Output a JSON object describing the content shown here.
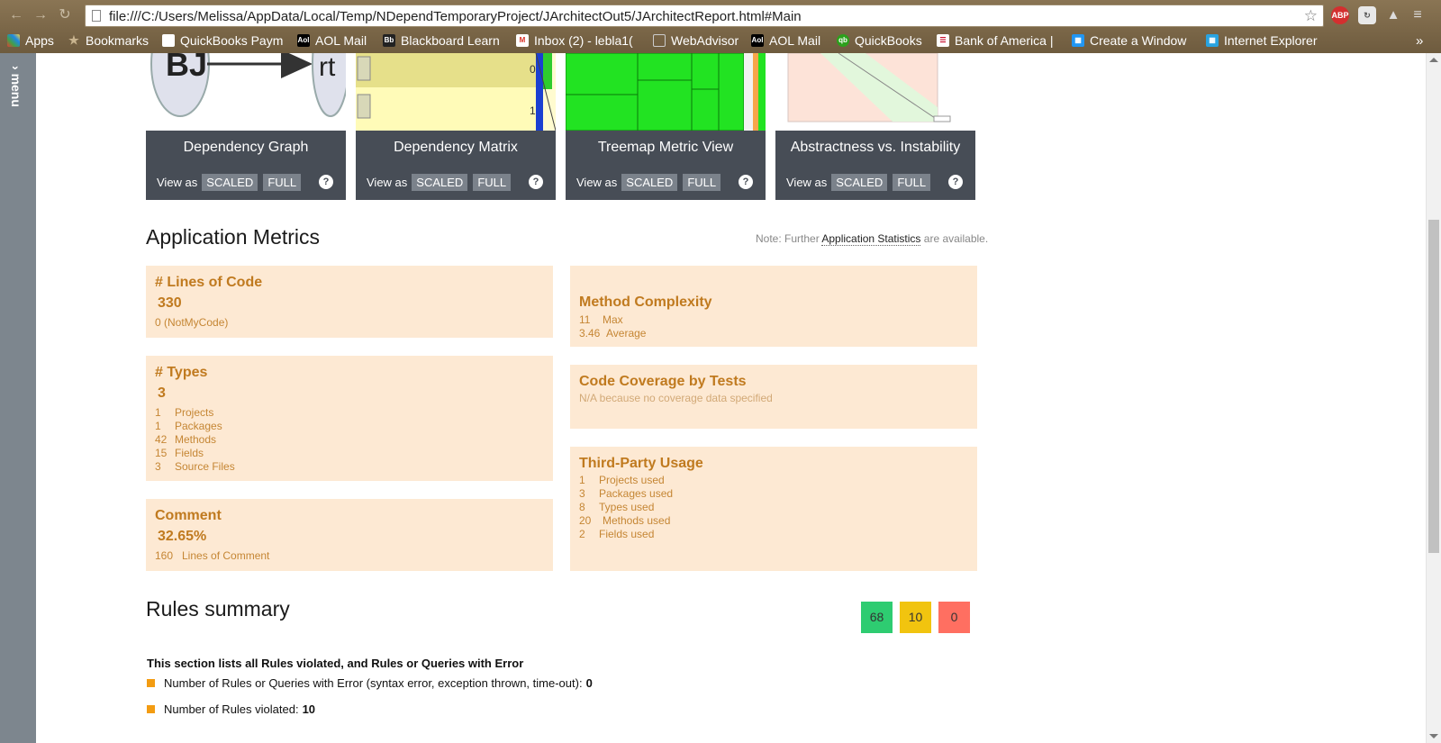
{
  "browser": {
    "url": "file:///C:/Users/Melissa/AppData/Local/Temp/NDependTemporaryProject/JArchitectOut5/JArchitectReport.html#Main",
    "extensions": [
      "ABP"
    ],
    "bookmarks": [
      {
        "label": "Apps"
      },
      {
        "label": "Bookmarks"
      },
      {
        "label": "QuickBooks Paym"
      },
      {
        "label": "AOL Mail"
      },
      {
        "label": "Blackboard Learn"
      },
      {
        "label": "Inbox (2) - lebla1("
      },
      {
        "label": "WebAdvisor"
      },
      {
        "label": "AOL Mail"
      },
      {
        "label": "QuickBooks"
      },
      {
        "label": "Bank of America |"
      },
      {
        "label": "Create a Window"
      },
      {
        "label": "Internet Explorer"
      }
    ]
  },
  "side_menu": {
    "label": "menu"
  },
  "cards": [
    {
      "title": "Dependency Graph",
      "view_as": "View as",
      "scaled": "SCALED",
      "full": "FULL",
      "help": "?",
      "thumb_text_a": "BJ",
      "thumb_text_b": "rt"
    },
    {
      "title": "Dependency Matrix",
      "view_as": "View as",
      "scaled": "SCALED",
      "full": "FULL",
      "help": "?"
    },
    {
      "title": "Treemap Metric View",
      "view_as": "View as",
      "scaled": "SCALED",
      "full": "FULL",
      "help": "?"
    },
    {
      "title": "Abstractness vs. Instability",
      "view_as": "View as",
      "scaled": "SCALED",
      "full": "FULL",
      "help": "?"
    }
  ],
  "app_metrics": {
    "title": "Application Metrics",
    "note_prefix": "Note: Further",
    "note_link": "Application Statistics",
    "note_suffix": "are available.",
    "loc": {
      "title": "# Lines of Code",
      "value": "330",
      "sub": "0 (NotMyCode)"
    },
    "types": {
      "title": "# Types",
      "value": "3",
      "rows": [
        {
          "n": "1",
          "label": "Projects"
        },
        {
          "n": "1",
          "label": "Packages"
        },
        {
          "n": "42",
          "label": "Methods"
        },
        {
          "n": "15",
          "label": "Fields"
        },
        {
          "n": "3",
          "label": "Source Files"
        }
      ]
    },
    "comment": {
      "title": "Comment",
      "value": "32.65%",
      "row": {
        "n": "160",
        "label": "Lines of Comment"
      }
    },
    "complexity": {
      "title": "Method Complexity",
      "rows": [
        {
          "n": "11",
          "label": "Max"
        },
        {
          "n": "3.46",
          "label": "Average"
        }
      ]
    },
    "coverage": {
      "title": "Code Coverage by Tests",
      "sub": "N/A because no coverage data specified"
    },
    "third_party": {
      "title": "Third-Party Usage",
      "rows": [
        {
          "n": "1",
          "label": "Projects used"
        },
        {
          "n": "3",
          "label": "Packages used"
        },
        {
          "n": "8",
          "label": "Types used"
        },
        {
          "n": "20",
          "label": "Methods used"
        },
        {
          "n": "2",
          "label": "Fields used"
        }
      ]
    }
  },
  "rules": {
    "title": "Rules summary",
    "badges": [
      {
        "value": "68",
        "color": "#2ecc71"
      },
      {
        "value": "10",
        "color": "#f1c40f"
      },
      {
        "value": "0",
        "color": "#ff6f61"
      }
    ],
    "subtitle": "This section lists all Rules violated, and Rules or Queries with Error",
    "items": [
      {
        "label": "Number of Rules or Queries with Error (syntax error, exception thrown, time-out):",
        "value": "0"
      },
      {
        "label": "Number of Rules violated:",
        "value": "10"
      }
    ]
  }
}
